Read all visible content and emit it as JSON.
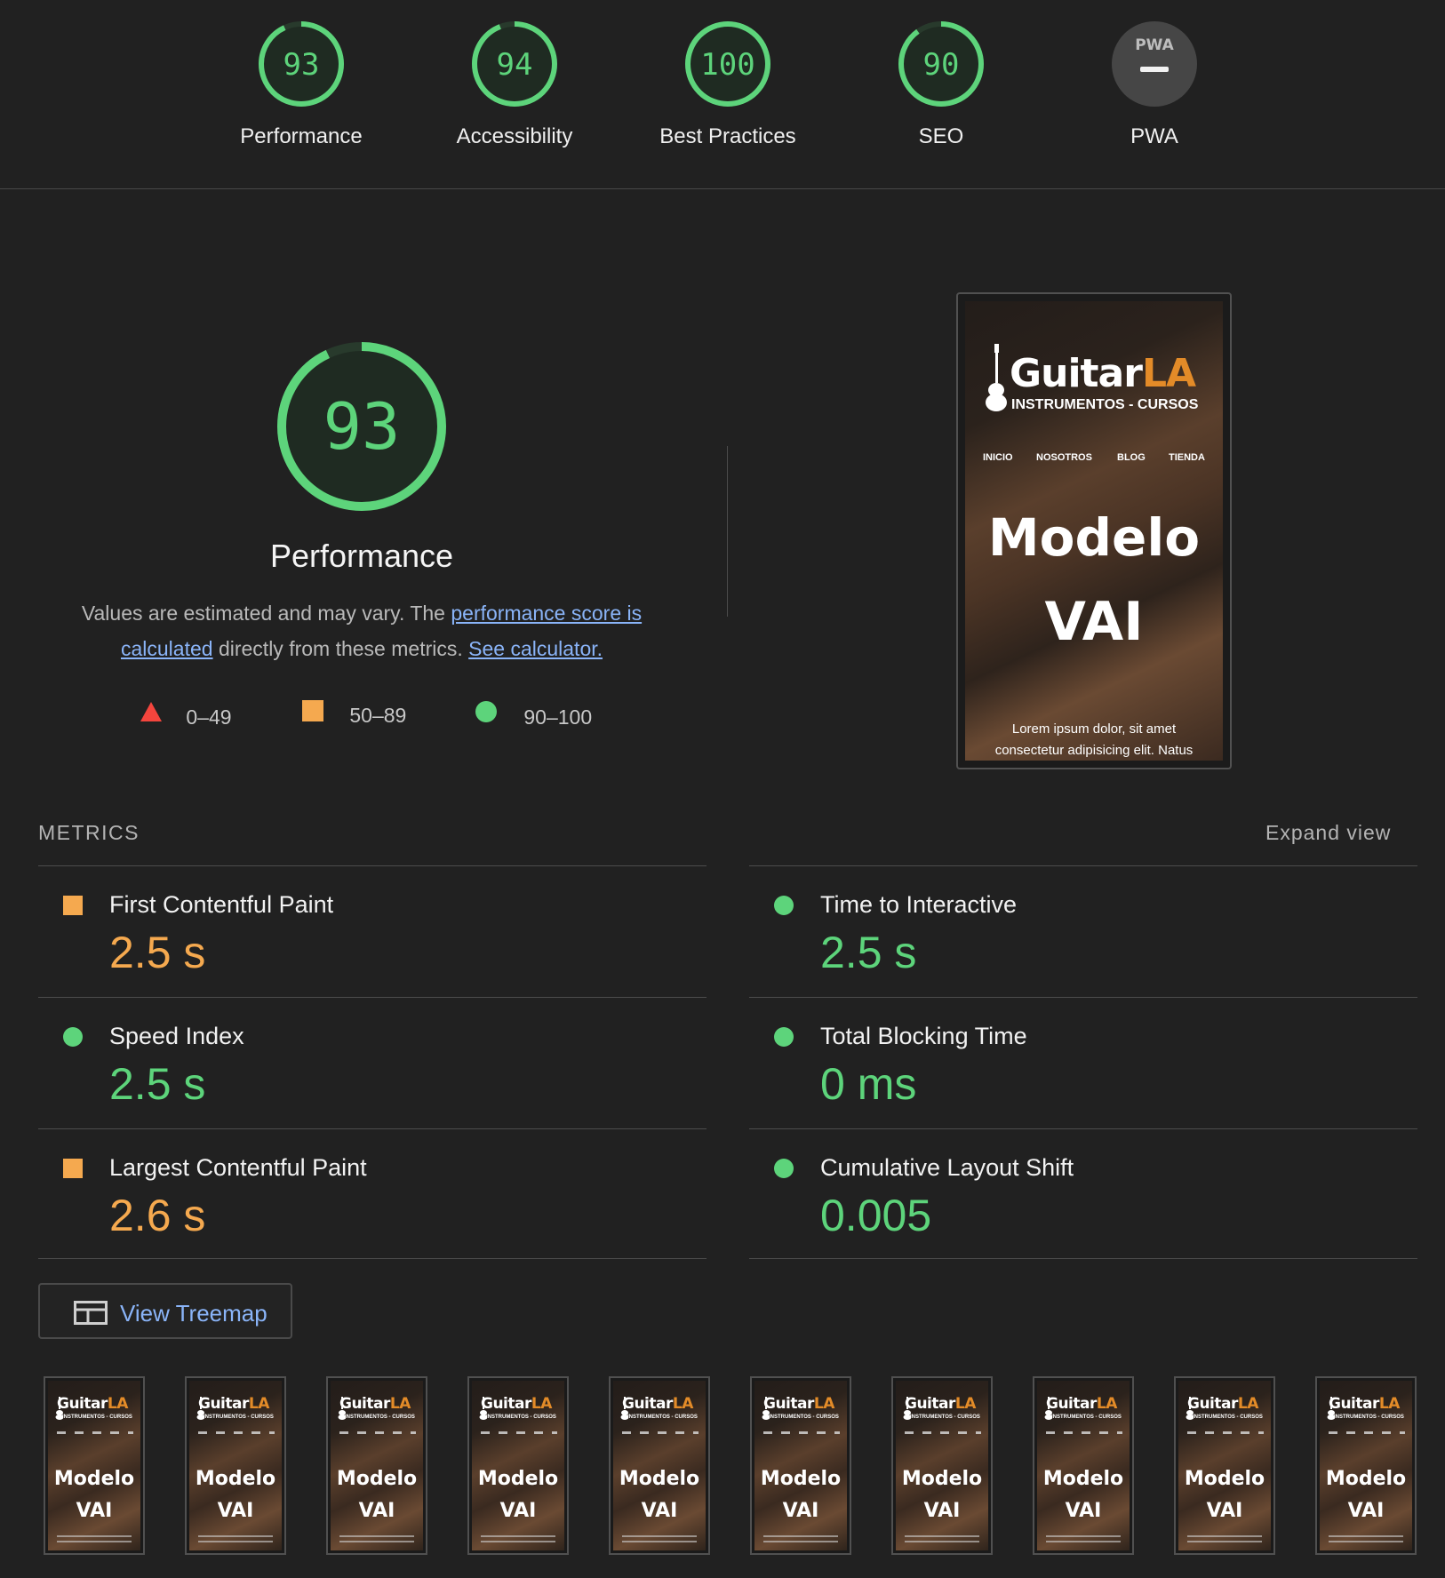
{
  "categories": [
    {
      "label": "Performance",
      "score": "93",
      "value": 93,
      "color": "#5dd47b"
    },
    {
      "label": "Accessibility",
      "score": "94",
      "value": 94,
      "color": "#5dd47b"
    },
    {
      "label": "Best Practices",
      "score": "100",
      "value": 100,
      "color": "#5dd47b"
    },
    {
      "label": "SEO",
      "score": "90",
      "value": 90,
      "color": "#5dd47b"
    },
    {
      "label": "PWA",
      "badge": "PWA",
      "value": null,
      "color": "#4a4a4a"
    }
  ],
  "hero": {
    "score": "93",
    "score_value": 93,
    "title": "Performance",
    "desc_prefix": "Values are estimated and may vary. The ",
    "desc_link1": "performance score is calculated",
    "desc_mid": " directly from these metrics. ",
    "desc_link2": "See calculator."
  },
  "legend": [
    {
      "range": "0–49",
      "shape": "triangle-icon",
      "color": "#f4453d"
    },
    {
      "range": "50–89",
      "shape": "square-icon",
      "color": "#f5a94f"
    },
    {
      "range": "90–100",
      "shape": "circle-icon",
      "color": "#5dd47b"
    }
  ],
  "screenshot": {
    "logo_main": "Guitar",
    "logo_accent": "LA",
    "logo_sub": "INSTRUMENTOS - CURSOS",
    "nav": [
      "INICIO",
      "NOSOTROS",
      "BLOG",
      "TIENDA"
    ],
    "heading_line1": "Modelo",
    "heading_line2": "VAI",
    "lorem_line1": "Lorem ipsum dolor, sit amet",
    "lorem_line2": "consectetur adipisicing elit. Natus"
  },
  "metrics_section": {
    "title": "METRICS",
    "expand_label": "Expand view"
  },
  "metrics": [
    {
      "label": "First Contentful Paint",
      "value": "2.5 s",
      "status": "average"
    },
    {
      "label": "Time to Interactive",
      "value": "2.5 s",
      "status": "pass"
    },
    {
      "label": "Speed Index",
      "value": "2.5 s",
      "status": "pass"
    },
    {
      "label": "Total Blocking Time",
      "value": "0 ms",
      "status": "pass"
    },
    {
      "label": "Largest Contentful Paint",
      "value": "2.6 s",
      "status": "average"
    },
    {
      "label": "Cumulative Layout Shift",
      "value": "0.005",
      "status": "pass"
    }
  ],
  "treemap_button": {
    "label": "View Treemap",
    "icon": "treemap-icon"
  },
  "filmstrip": {
    "count": 10,
    "logo_main": "Guitar",
    "logo_accent": "LA",
    "logo_sub": "INSTRUMENTOS - CURSOS",
    "heading_line1": "Modelo",
    "heading_line2": "VAI"
  },
  "colors": {
    "pass": "#5dd47b",
    "average": "#f5a94f",
    "fail": "#f4453d",
    "link": "#8ab4f8",
    "background": "#212121"
  }
}
